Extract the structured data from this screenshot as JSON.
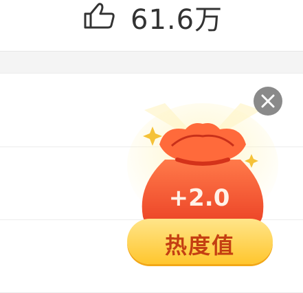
{
  "like": {
    "icon": "thumbs-up-icon",
    "count": "61.6万"
  },
  "reward": {
    "icon": "red-lucky-bag-icon",
    "value": "+2.0",
    "label": "热度值",
    "close_icon": "close-icon"
  },
  "colors": {
    "bag": "#f5522d",
    "pill": "#ffd24a",
    "pill_text": "#c43f12",
    "close_bg": "#8a8a8a"
  }
}
